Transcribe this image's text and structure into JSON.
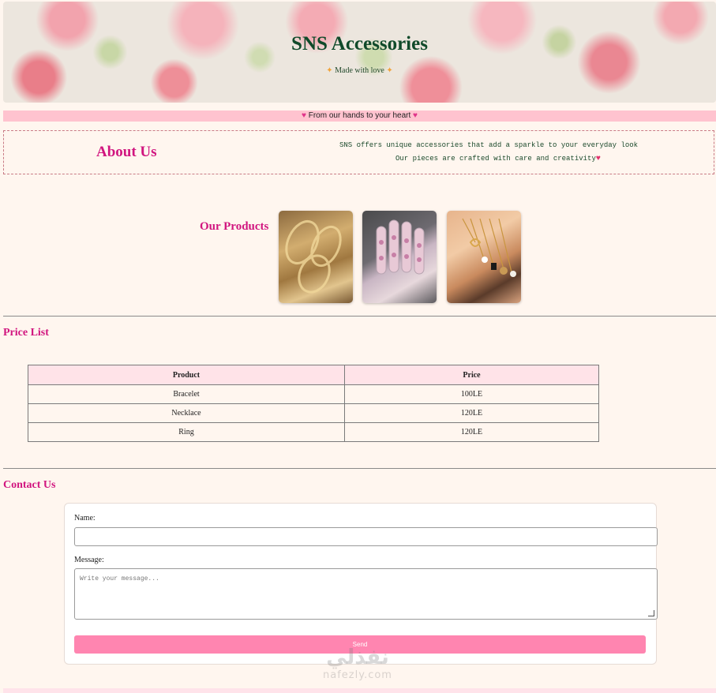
{
  "header": {
    "title": "SNS Accessories",
    "subtitle": "Made with love",
    "subtitle_icon": "sparkle-icon"
  },
  "tagline": {
    "text": "From our hands to your heart",
    "icon": "pink-heart-icon"
  },
  "about": {
    "title": "About Us",
    "line1": "SNS offers unique accessories that add a sparkle to your everyday look",
    "line2": "Our pieces are crafted with care and creativity"
  },
  "products": {
    "title": "Our Products",
    "images": [
      {
        "name": "bracelets-image",
        "subject": "gold bracelets"
      },
      {
        "name": "rings-image",
        "subject": "rings on hand"
      },
      {
        "name": "necklaces-image",
        "subject": "necklaces on hand"
      }
    ]
  },
  "price_list": {
    "title": "Price List",
    "headers": [
      "Product",
      "Price"
    ],
    "rows": [
      [
        "Bracelet",
        "100LE"
      ],
      [
        "Necklace",
        "120LE"
      ],
      [
        "Ring",
        "120LE"
      ]
    ]
  },
  "contact": {
    "title": "Contact Us",
    "name_label": "Name:",
    "name_value": "",
    "message_label": "Message:",
    "message_placeholder": "Write your message...",
    "send_label": "Send"
  },
  "watermark": {
    "text_ar": "نفذلي",
    "text_en": "nafezly.com"
  },
  "colors": {
    "accent": "#d1157f",
    "header_text": "#104a2a",
    "tagline_bg": "#ffc3cf",
    "button": "#ff85b0",
    "page_bg": "#fff6ef"
  }
}
